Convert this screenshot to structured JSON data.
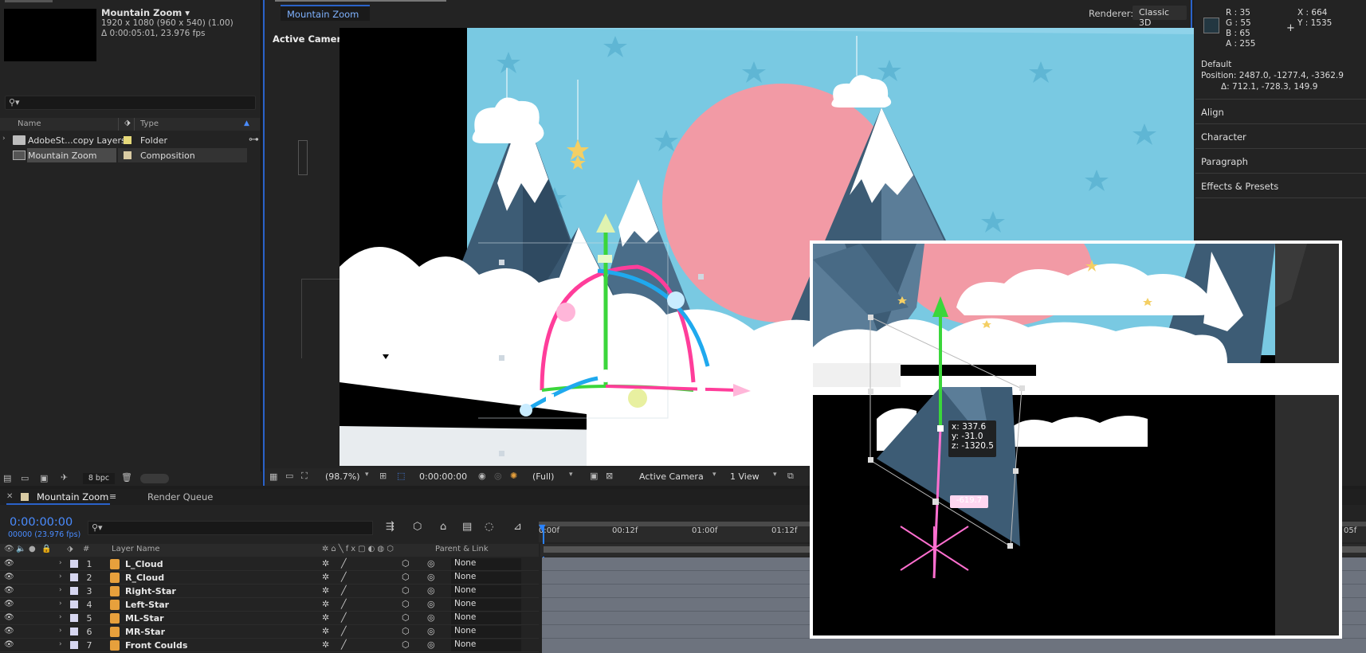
{
  "project": {
    "comp_title": "Mountain Zoom ▾",
    "resolution": "1920 x 1080  (960 x 540) (1.00)",
    "duration": "Δ 0:00:05:01, 23.976 fps",
    "search_placeholder": "",
    "columns": {
      "name": "Name",
      "type": "Type"
    },
    "items": [
      {
        "name": "AdobeSt...copy Layers",
        "type": "Folder",
        "label_color": "#e6d97a"
      },
      {
        "name": "Mountain Zoom",
        "type": "Composition",
        "label_color": "#d9cba3"
      }
    ],
    "bpc": "8 bpc"
  },
  "viewer": {
    "tab": "Mountain Zoom",
    "active_camera": "Active Camera",
    "renderer_label": "Renderer:",
    "renderer_value": "Classic 3D",
    "bar": {
      "zoom": "(98.7%)",
      "timecode": "0:00:00:00",
      "resolution": "(Full)",
      "camera": "Active Camera",
      "views": "1 View"
    }
  },
  "info": {
    "r": "R :  35",
    "g": "G :  55",
    "b": "B :  65",
    "a": "A :  255",
    "x": "X :  664",
    "y": "Y :  1535",
    "swatch_color": "#233741",
    "default_label": "Default",
    "position": "Position: 2487.0, -1277.4, -3362.9",
    "delta": "Δ: 712.1, -728.3, 149.9",
    "panels": [
      "Align",
      "Character",
      "Paragraph",
      "Effects & Presets"
    ]
  },
  "timeline": {
    "tab": "Mountain Zoom",
    "tab_menu": "≡",
    "render_queue": "Render Queue",
    "timecode": "0:00:00:00",
    "frames": "00000 (23.976 fps)",
    "search_placeholder": "",
    "header": {
      "num": "#",
      "layer_name": "Layer Name",
      "parent": "Parent & Link"
    },
    "ruler": [
      "0:00f",
      "00:12f",
      "01:00f",
      "01:12f",
      "05f"
    ],
    "layers": [
      {
        "num": "1",
        "name": "L_Cloud",
        "parent": "None"
      },
      {
        "num": "2",
        "name": "R_Cloud",
        "parent": "None"
      },
      {
        "num": "3",
        "name": "Right-Star",
        "parent": "None"
      },
      {
        "num": "4",
        "name": "Left-Star",
        "parent": "None"
      },
      {
        "num": "5",
        "name": "ML-Star",
        "parent": "None"
      },
      {
        "num": "6",
        "name": "MR-Star",
        "parent": "None"
      },
      {
        "num": "7",
        "name": "Front Coulds",
        "parent": "None"
      }
    ]
  },
  "zoom_overlay": {
    "coords": {
      "x": "x: 337.6",
      "y": "y: -31.0",
      "z": "z: -1320.5"
    },
    "z_badge": "-619.7"
  },
  "colors": {
    "accent": "#2a62c9",
    "sky": "#79c9e2",
    "sun": "#f29aa5",
    "mountain": "#3d5c75",
    "axis_x": "#ff3d9a",
    "axis_y": "#3bd63b",
    "axis_z": "#1fa9ee"
  }
}
